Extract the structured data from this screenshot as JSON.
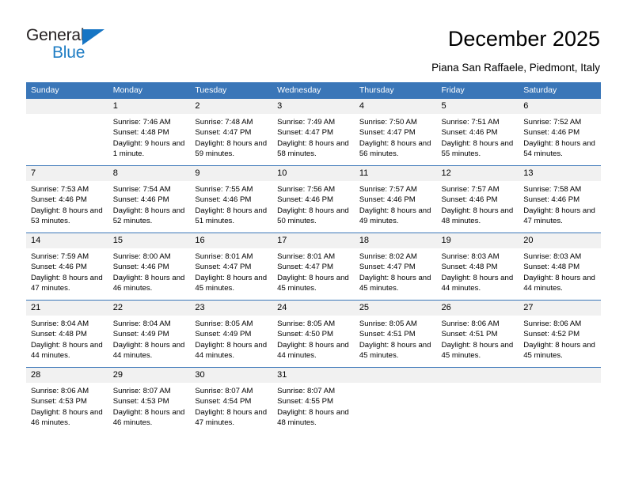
{
  "logo": {
    "word_top": "General",
    "word_bottom": "Blue",
    "triangle_color": "#1675c4",
    "text_color_top": "#231f20",
    "text_color_bottom": "#1f7dc4"
  },
  "header": {
    "title": "December 2025",
    "subtitle": "Piana San Raffaele, Piedmont, Italy"
  },
  "theme": {
    "header_blue": "#3a76b8",
    "daynum_band": "#f1f1f1",
    "cell_background": "#ffffff"
  },
  "weekday_headers": [
    "Sunday",
    "Monday",
    "Tuesday",
    "Wednesday",
    "Thursday",
    "Friday",
    "Saturday"
  ],
  "weeks": [
    [
      {
        "day": "",
        "sunrise": "",
        "sunset": "",
        "daylight": "",
        "blank": true
      },
      {
        "day": "1",
        "sunrise": "Sunrise: 7:46 AM",
        "sunset": "Sunset: 4:48 PM",
        "daylight": "Daylight: 9 hours and 1 minute."
      },
      {
        "day": "2",
        "sunrise": "Sunrise: 7:48 AM",
        "sunset": "Sunset: 4:47 PM",
        "daylight": "Daylight: 8 hours and 59 minutes."
      },
      {
        "day": "3",
        "sunrise": "Sunrise: 7:49 AM",
        "sunset": "Sunset: 4:47 PM",
        "daylight": "Daylight: 8 hours and 58 minutes."
      },
      {
        "day": "4",
        "sunrise": "Sunrise: 7:50 AM",
        "sunset": "Sunset: 4:47 PM",
        "daylight": "Daylight: 8 hours and 56 minutes."
      },
      {
        "day": "5",
        "sunrise": "Sunrise: 7:51 AM",
        "sunset": "Sunset: 4:46 PM",
        "daylight": "Daylight: 8 hours and 55 minutes."
      },
      {
        "day": "6",
        "sunrise": "Sunrise: 7:52 AM",
        "sunset": "Sunset: 4:46 PM",
        "daylight": "Daylight: 8 hours and 54 minutes."
      }
    ],
    [
      {
        "day": "7",
        "sunrise": "Sunrise: 7:53 AM",
        "sunset": "Sunset: 4:46 PM",
        "daylight": "Daylight: 8 hours and 53 minutes."
      },
      {
        "day": "8",
        "sunrise": "Sunrise: 7:54 AM",
        "sunset": "Sunset: 4:46 PM",
        "daylight": "Daylight: 8 hours and 52 minutes."
      },
      {
        "day": "9",
        "sunrise": "Sunrise: 7:55 AM",
        "sunset": "Sunset: 4:46 PM",
        "daylight": "Daylight: 8 hours and 51 minutes."
      },
      {
        "day": "10",
        "sunrise": "Sunrise: 7:56 AM",
        "sunset": "Sunset: 4:46 PM",
        "daylight": "Daylight: 8 hours and 50 minutes."
      },
      {
        "day": "11",
        "sunrise": "Sunrise: 7:57 AM",
        "sunset": "Sunset: 4:46 PM",
        "daylight": "Daylight: 8 hours and 49 minutes."
      },
      {
        "day": "12",
        "sunrise": "Sunrise: 7:57 AM",
        "sunset": "Sunset: 4:46 PM",
        "daylight": "Daylight: 8 hours and 48 minutes."
      },
      {
        "day": "13",
        "sunrise": "Sunrise: 7:58 AM",
        "sunset": "Sunset: 4:46 PM",
        "daylight": "Daylight: 8 hours and 47 minutes."
      }
    ],
    [
      {
        "day": "14",
        "sunrise": "Sunrise: 7:59 AM",
        "sunset": "Sunset: 4:46 PM",
        "daylight": "Daylight: 8 hours and 47 minutes."
      },
      {
        "day": "15",
        "sunrise": "Sunrise: 8:00 AM",
        "sunset": "Sunset: 4:46 PM",
        "daylight": "Daylight: 8 hours and 46 minutes."
      },
      {
        "day": "16",
        "sunrise": "Sunrise: 8:01 AM",
        "sunset": "Sunset: 4:47 PM",
        "daylight": "Daylight: 8 hours and 45 minutes."
      },
      {
        "day": "17",
        "sunrise": "Sunrise: 8:01 AM",
        "sunset": "Sunset: 4:47 PM",
        "daylight": "Daylight: 8 hours and 45 minutes."
      },
      {
        "day": "18",
        "sunrise": "Sunrise: 8:02 AM",
        "sunset": "Sunset: 4:47 PM",
        "daylight": "Daylight: 8 hours and 45 minutes."
      },
      {
        "day": "19",
        "sunrise": "Sunrise: 8:03 AM",
        "sunset": "Sunset: 4:48 PM",
        "daylight": "Daylight: 8 hours and 44 minutes."
      },
      {
        "day": "20",
        "sunrise": "Sunrise: 8:03 AM",
        "sunset": "Sunset: 4:48 PM",
        "daylight": "Daylight: 8 hours and 44 minutes."
      }
    ],
    [
      {
        "day": "21",
        "sunrise": "Sunrise: 8:04 AM",
        "sunset": "Sunset: 4:48 PM",
        "daylight": "Daylight: 8 hours and 44 minutes."
      },
      {
        "day": "22",
        "sunrise": "Sunrise: 8:04 AM",
        "sunset": "Sunset: 4:49 PM",
        "daylight": "Daylight: 8 hours and 44 minutes."
      },
      {
        "day": "23",
        "sunrise": "Sunrise: 8:05 AM",
        "sunset": "Sunset: 4:49 PM",
        "daylight": "Daylight: 8 hours and 44 minutes."
      },
      {
        "day": "24",
        "sunrise": "Sunrise: 8:05 AM",
        "sunset": "Sunset: 4:50 PM",
        "daylight": "Daylight: 8 hours and 44 minutes."
      },
      {
        "day": "25",
        "sunrise": "Sunrise: 8:05 AM",
        "sunset": "Sunset: 4:51 PM",
        "daylight": "Daylight: 8 hours and 45 minutes."
      },
      {
        "day": "26",
        "sunrise": "Sunrise: 8:06 AM",
        "sunset": "Sunset: 4:51 PM",
        "daylight": "Daylight: 8 hours and 45 minutes."
      },
      {
        "day": "27",
        "sunrise": "Sunrise: 8:06 AM",
        "sunset": "Sunset: 4:52 PM",
        "daylight": "Daylight: 8 hours and 45 minutes."
      }
    ],
    [
      {
        "day": "28",
        "sunrise": "Sunrise: 8:06 AM",
        "sunset": "Sunset: 4:53 PM",
        "daylight": "Daylight: 8 hours and 46 minutes."
      },
      {
        "day": "29",
        "sunrise": "Sunrise: 8:07 AM",
        "sunset": "Sunset: 4:53 PM",
        "daylight": "Daylight: 8 hours and 46 minutes."
      },
      {
        "day": "30",
        "sunrise": "Sunrise: 8:07 AM",
        "sunset": "Sunset: 4:54 PM",
        "daylight": "Daylight: 8 hours and 47 minutes."
      },
      {
        "day": "31",
        "sunrise": "Sunrise: 8:07 AM",
        "sunset": "Sunset: 4:55 PM",
        "daylight": "Daylight: 8 hours and 48 minutes."
      },
      {
        "day": "",
        "sunrise": "",
        "sunset": "",
        "daylight": "",
        "blank": true
      },
      {
        "day": "",
        "sunrise": "",
        "sunset": "",
        "daylight": "",
        "blank": true
      },
      {
        "day": "",
        "sunrise": "",
        "sunset": "",
        "daylight": "",
        "blank": true
      }
    ]
  ]
}
